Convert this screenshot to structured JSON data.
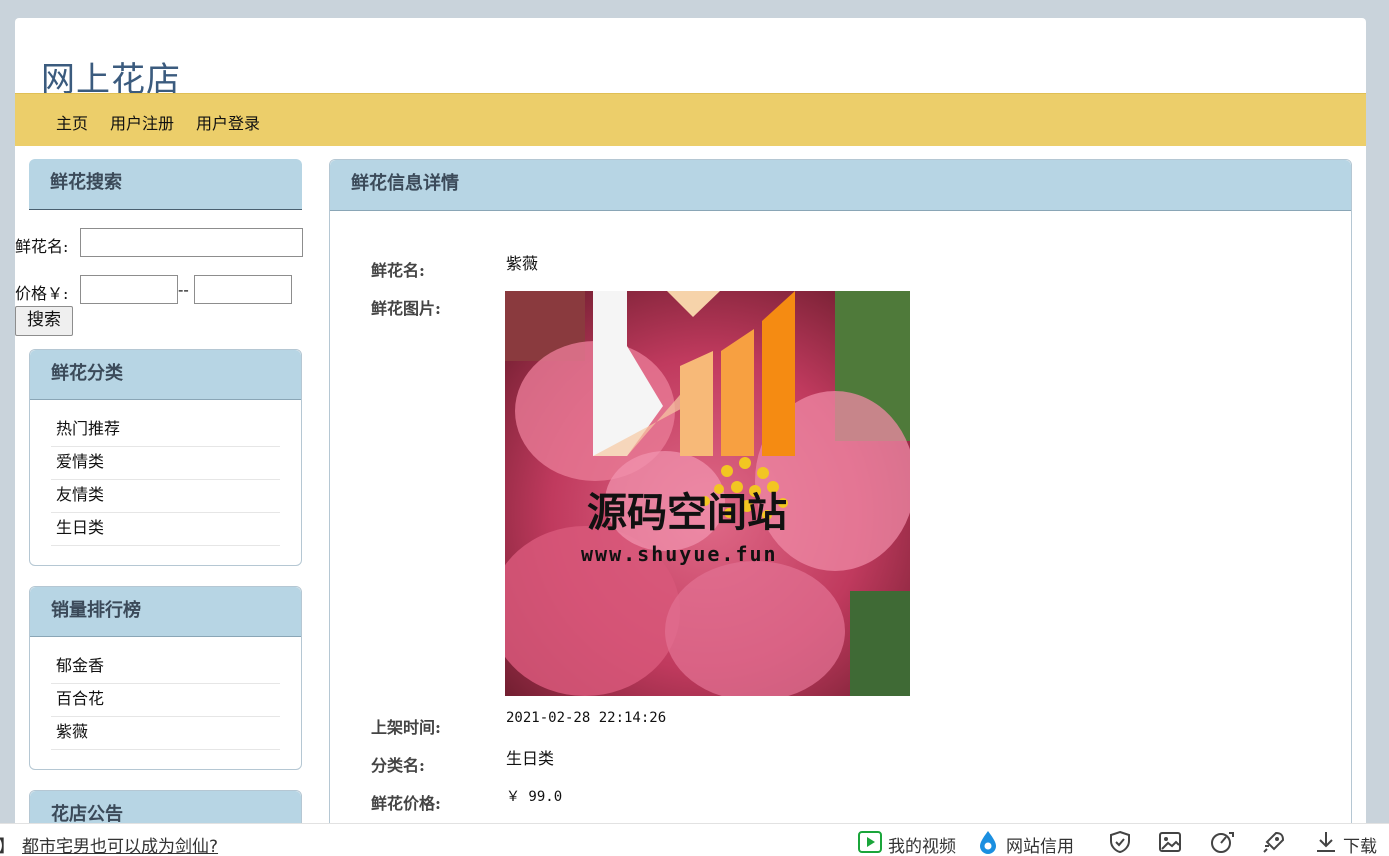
{
  "site": {
    "title": "网上花店"
  },
  "nav": {
    "items": [
      "主页",
      "用户注册",
      "用户登录"
    ]
  },
  "search": {
    "title": "鲜花搜索",
    "name_label": "鲜花名:",
    "price_label": "价格￥:",
    "separator": "--",
    "button": "搜索"
  },
  "categories": {
    "title": "鲜花分类",
    "items": [
      "热门推荐",
      "爱情类",
      "友情类",
      "生日类"
    ]
  },
  "ranking": {
    "title": "销量排行榜",
    "items": [
      "郁金香",
      "百合花",
      "紫薇"
    ]
  },
  "notice": {
    "title": "花店公告"
  },
  "detail": {
    "title": "鲜花信息详情",
    "name_label": "鲜花名:",
    "name": "紫薇",
    "image_label": "鲜花图片:",
    "time_label": "上架时间:",
    "time": "2021-02-28 22:14:26",
    "category_label": "分类名:",
    "category": "生日类",
    "price_label": "鲜花价格:",
    "price": "￥ 99.0"
  },
  "watermark": {
    "line1": "源码空间站",
    "line2": "www.shuyue.fun"
  },
  "bottombar": {
    "left_bracket": "】",
    "headline": "都市宅男也可以成为剑仙?",
    "my_videos": "我的视频",
    "site_credit": "网站信用",
    "download": "下载"
  },
  "colors": {
    "nav_bg": "#ecce6a",
    "panel_head": "#b7d5e4",
    "title": "#3b5b7e"
  }
}
